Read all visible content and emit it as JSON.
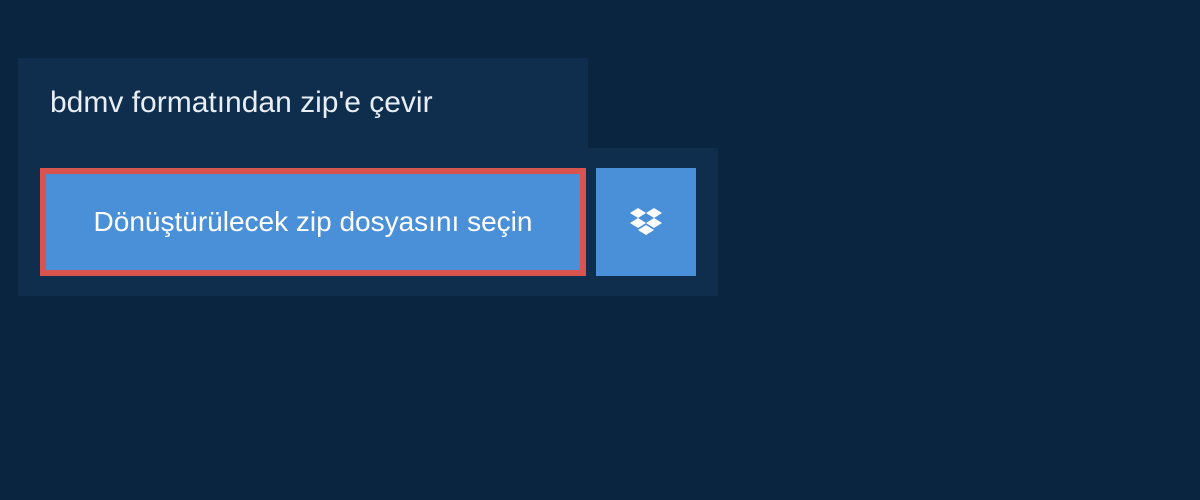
{
  "header": {
    "title": "bdmv formatından zip'e çevir"
  },
  "upload": {
    "select_file_label": "Dönüştürülecek zip dosyasını seçin",
    "dropbox_icon_name": "dropbox-icon"
  },
  "colors": {
    "background": "#0a2540",
    "panel": "#0f2e4d",
    "button": "#4a90d9",
    "highlight_border": "#d9534f",
    "text_light": "#e8eef5",
    "text_white": "#ffffff"
  }
}
